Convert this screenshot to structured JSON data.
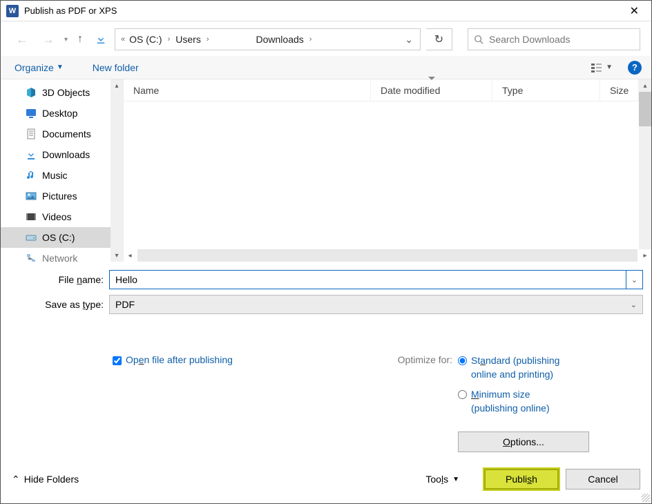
{
  "titlebar": {
    "title": "Publish as PDF or XPS"
  },
  "path": {
    "seg1": "OS (C:)",
    "seg2": "Users",
    "seg3": "Downloads"
  },
  "search": {
    "placeholder": "Search Downloads"
  },
  "toolbar": {
    "organize": "Organize",
    "newfolder": "New folder",
    "help": "?"
  },
  "sidebar": {
    "items": [
      {
        "label": "3D Objects"
      },
      {
        "label": "Desktop"
      },
      {
        "label": "Documents"
      },
      {
        "label": "Downloads"
      },
      {
        "label": "Music"
      },
      {
        "label": "Pictures"
      },
      {
        "label": "Videos"
      },
      {
        "label": "OS (C:)"
      },
      {
        "label": "Network"
      }
    ]
  },
  "columns": {
    "name": "Name",
    "date": "Date modified",
    "type": "Type",
    "size": "Size"
  },
  "form": {
    "filename_label_pre": "File ",
    "filename_label_u": "n",
    "filename_label_post": "ame:",
    "filename_value": "Hello",
    "saveas_label_pre": "Save as ",
    "saveas_label_u": "t",
    "saveas_label_post": "ype:",
    "saveas_value": "PDF"
  },
  "options": {
    "open_after_pre": "Op",
    "open_after_u": "e",
    "open_after_post": "n file after publishing",
    "optimize_label": "Optimize for:",
    "standard_pre": "Standard (publishing online and printing)",
    "standard_u": "",
    "minimum_pre": "",
    "minimum_u": "M",
    "minimum_post": "inimum size (publishing online)",
    "options_btn_pre": "",
    "options_btn_u": "O",
    "options_btn_post": "ptions..."
  },
  "footer": {
    "hide_folders": "Hide Folders",
    "tools_pre": "Too",
    "tools_u": "l",
    "tools_post": "s",
    "publish_pre": "Publi",
    "publish_u": "s",
    "publish_post": "h",
    "cancel": "Cancel"
  }
}
